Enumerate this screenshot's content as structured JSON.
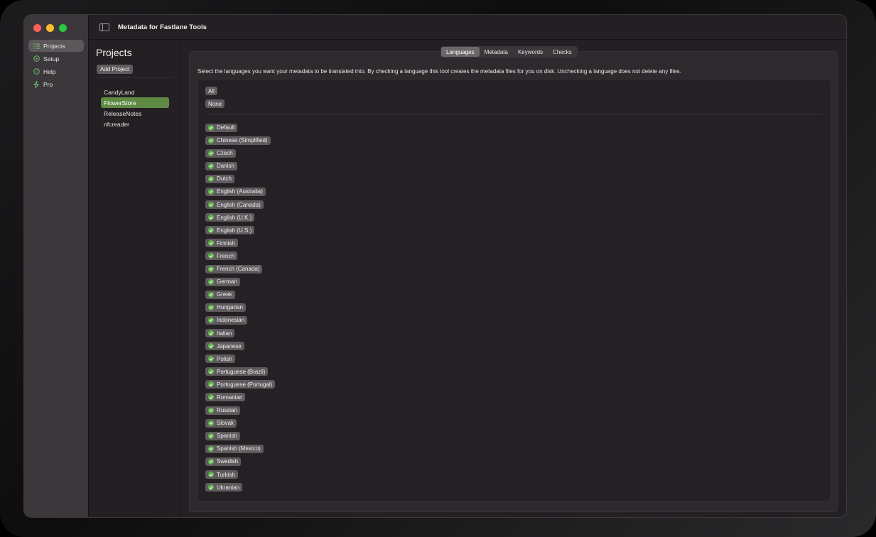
{
  "window": {
    "title": "Metadata for Fastlane Tools"
  },
  "sidebar": {
    "items": [
      {
        "label": "Projects",
        "icon": "list-icon",
        "active": true
      },
      {
        "label": "Setup",
        "icon": "play-circle-icon",
        "active": false
      },
      {
        "label": "Help",
        "icon": "question-circle-icon",
        "active": false
      },
      {
        "label": "Pro",
        "icon": "bolt-icon",
        "active": false
      }
    ]
  },
  "projects": {
    "title": "Projects",
    "add_label": "Add Project",
    "items": [
      {
        "label": "CandyLand",
        "selected": false
      },
      {
        "label": "FlowerStore",
        "selected": true
      },
      {
        "label": "ReleaseNotes",
        "selected": false
      },
      {
        "label": "nfcreader",
        "selected": false
      }
    ]
  },
  "tabs": [
    {
      "label": "Languages",
      "active": true
    },
    {
      "label": "Metadata",
      "active": false
    },
    {
      "label": "Keywords",
      "active": false
    },
    {
      "label": "Checks",
      "active": false
    }
  ],
  "languages": {
    "instruction": "Select the languages you want your metadata to be translated into. By checking a language this tool creates the metadata files for you on disk. Unchecking a language does not delete any files.",
    "all_label": "All",
    "none_label": "None",
    "items": [
      "Default",
      "Chinese (Simplified)",
      "Czech",
      "Danish",
      "Dutch",
      "English (Australia)",
      "English (Canada)",
      "English (U.K.)",
      "English (U.S.)",
      "Finnish",
      "French",
      "French (Canada)",
      "German",
      "Greek",
      "Hungarian",
      "Indonesian",
      "Italian",
      "Japanese",
      "Polish",
      "Portuguese (Brazil)",
      "Portuguese (Portugal)",
      "Romanian",
      "Russian",
      "Slovak",
      "Spanish",
      "Spanish (Mexico)",
      "Swedish",
      "Turkish",
      "Ukranian"
    ]
  },
  "colors": {
    "accent": "#5e8a43",
    "check": "#62b04a"
  }
}
